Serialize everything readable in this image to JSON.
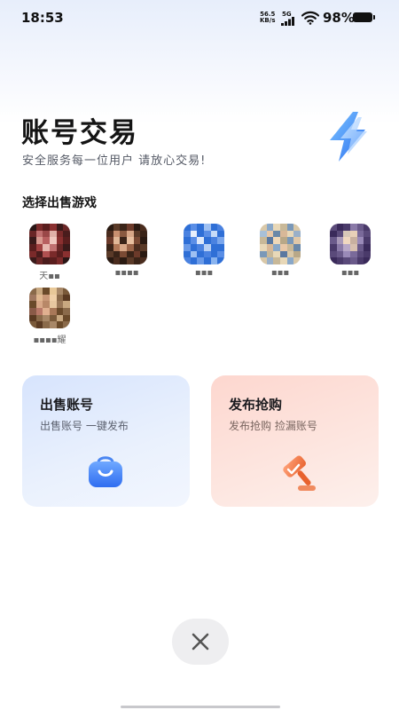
{
  "status_bar": {
    "time": "18:53",
    "net_speed_value": "56.5",
    "net_speed_unit": "KB/s",
    "network_type": "5G",
    "battery": "98%"
  },
  "header": {
    "title": "账号交易",
    "subtitle": "安全服务每一位用户 请放心交易!",
    "icon": "lightning-bolt-icon"
  },
  "games_section": {
    "title": "选择出售游戏",
    "games": [
      {
        "name": "天▪▪",
        "icon_color": "#7a2a2a"
      },
      {
        "name": "▪▪▪▪",
        "icon_color": "#6b3a2a"
      },
      {
        "name": "▪▪▪",
        "icon_color": "#2f6fd6"
      },
      {
        "name": "▪▪▪",
        "icon_color": "#d9c8a8"
      },
      {
        "name": "▪▪▪",
        "icon_color": "#5a4a7a"
      },
      {
        "name": "▪▪▪▪耀",
        "icon_color": "#8a6a4a"
      }
    ]
  },
  "cards": {
    "sell": {
      "title": "出售账号",
      "subtitle": "出售账号 一键发布",
      "icon": "shopping-bag-icon",
      "accent": "#3b7cf6"
    },
    "buy": {
      "title": "发布抢购",
      "subtitle": "发布抢购 捡漏账号",
      "icon": "gavel-icon",
      "accent": "#f07a4a"
    }
  },
  "close_button": {
    "icon": "close-icon"
  }
}
